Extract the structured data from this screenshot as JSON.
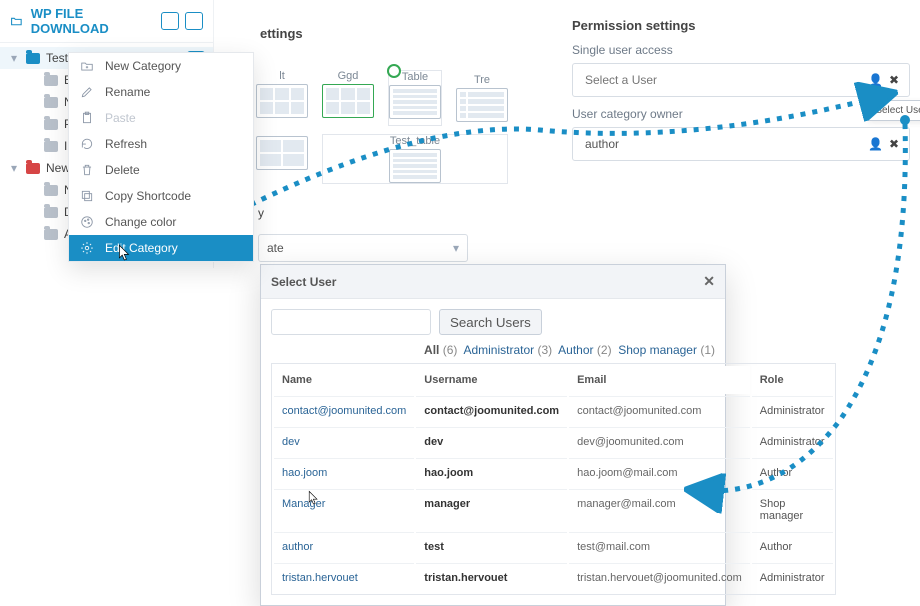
{
  "app_title": "WP FILE DOWNLOAD",
  "tree": {
    "root": "Test",
    "children": [
      "BM",
      "New",
      "PPI",
      "IMT"
    ],
    "group2_root": "New",
    "group2_children": [
      "Nc",
      "Des",
      "Ado"
    ]
  },
  "context_menu": {
    "items": [
      {
        "label": "New Category",
        "icon": "folder-plus"
      },
      {
        "label": "Rename",
        "icon": "pencil"
      },
      {
        "label": "Paste",
        "icon": "clipboard",
        "disabled": true
      },
      {
        "label": "Refresh",
        "icon": "refresh"
      },
      {
        "label": "Delete",
        "icon": "trash"
      },
      {
        "label": "Copy Shortcode",
        "icon": "copy"
      },
      {
        "label": "Change color",
        "icon": "palette"
      },
      {
        "label": "Edit Category",
        "icon": "gear",
        "active": true
      }
    ]
  },
  "center": {
    "title": "ettings",
    "themes_row1": [
      {
        "name": "lt"
      },
      {
        "name": "Ggd",
        "selected": true
      },
      {
        "name": "Table"
      },
      {
        "name": "Tre"
      }
    ],
    "themes_row2": [
      {
        "name": ""
      },
      {
        "name": "Test_table"
      }
    ],
    "section_label": "y",
    "select_value": "ate"
  },
  "permission": {
    "title": "Permission settings",
    "single_access_label": "Single user access",
    "single_access_placeholder": "Select a User",
    "owner_label": "User category owner",
    "owner_value": "author",
    "tooltip": "Select User"
  },
  "modal": {
    "title": "Select User",
    "search_button": "Search Users",
    "filters": {
      "all_label": "All",
      "all_count": 6,
      "admin_label": "Administrator",
      "admin_count": 3,
      "author_label": "Author",
      "author_count": 2,
      "shop_label": "Shop manager",
      "shop_count": 1
    },
    "columns": [
      "Name",
      "Username",
      "Email",
      "Role"
    ],
    "rows": [
      {
        "name": "contact@joomunited.com",
        "username": "contact@joomunited.com",
        "email": "contact@joomunited.com",
        "role": "Administrator"
      },
      {
        "name": "dev",
        "username": "dev",
        "email": "dev@joomunited.com",
        "role": "Administrator"
      },
      {
        "name": "hao.joom",
        "username": "hao.joom",
        "email": "hao.joom@mail.com",
        "role": "Author"
      },
      {
        "name": "Manager",
        "username": "manager",
        "email": "manager@mail.com",
        "role": "Shop manager"
      },
      {
        "name": "author",
        "username": "test",
        "email": "test@mail.com",
        "role": "Author"
      },
      {
        "name": "tristan.hervouet",
        "username": "tristan.hervouet",
        "email": "tristan.hervouet@joomunited.com",
        "role": "Administrator"
      }
    ]
  }
}
